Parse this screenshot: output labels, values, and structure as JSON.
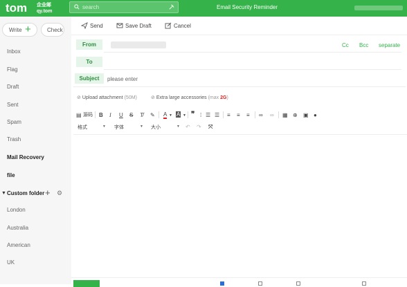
{
  "header": {
    "logo_main": "tom",
    "logo_cn": "企业邮",
    "logo_sub": "qy.tom",
    "search_placeholder": "search",
    "reminder": "Email Security Reminder"
  },
  "sidebar": {
    "write_label": "Write",
    "check_label": "Check",
    "items": [
      "Inbox",
      "Flag",
      "Draft",
      "Sent",
      "Spam",
      "Trash",
      "Mail Recovery",
      "file"
    ],
    "custom_folder_label": "Custom folder",
    "custom_folders": [
      "London",
      "Australia",
      "American",
      "UK"
    ]
  },
  "toolbar": {
    "send": "Send",
    "save_draft": "Save Draft",
    "cancel": "Cancel"
  },
  "compose": {
    "from_label": "From",
    "to_label": "To",
    "subject_label": "Subject",
    "subject_placeholder": "please enter",
    "cc": "Cc",
    "bcc": "Bcc",
    "separate": "separate"
  },
  "attachments": {
    "upload_label": "Upload attachment",
    "upload_limit": "(50M)",
    "large_label": "Extra large accessories",
    "large_limit_prefix": "(max",
    "large_limit_value": "2G",
    "large_limit_suffix": ")"
  },
  "editor_toolbar": {
    "source_label": "源码",
    "format_select": "格式",
    "font_select": "字体",
    "size_select": "大小"
  },
  "colors": {
    "brand_green": "#35b34a",
    "label_bg": "#e6f5e9",
    "accent_red": "#e02020"
  }
}
